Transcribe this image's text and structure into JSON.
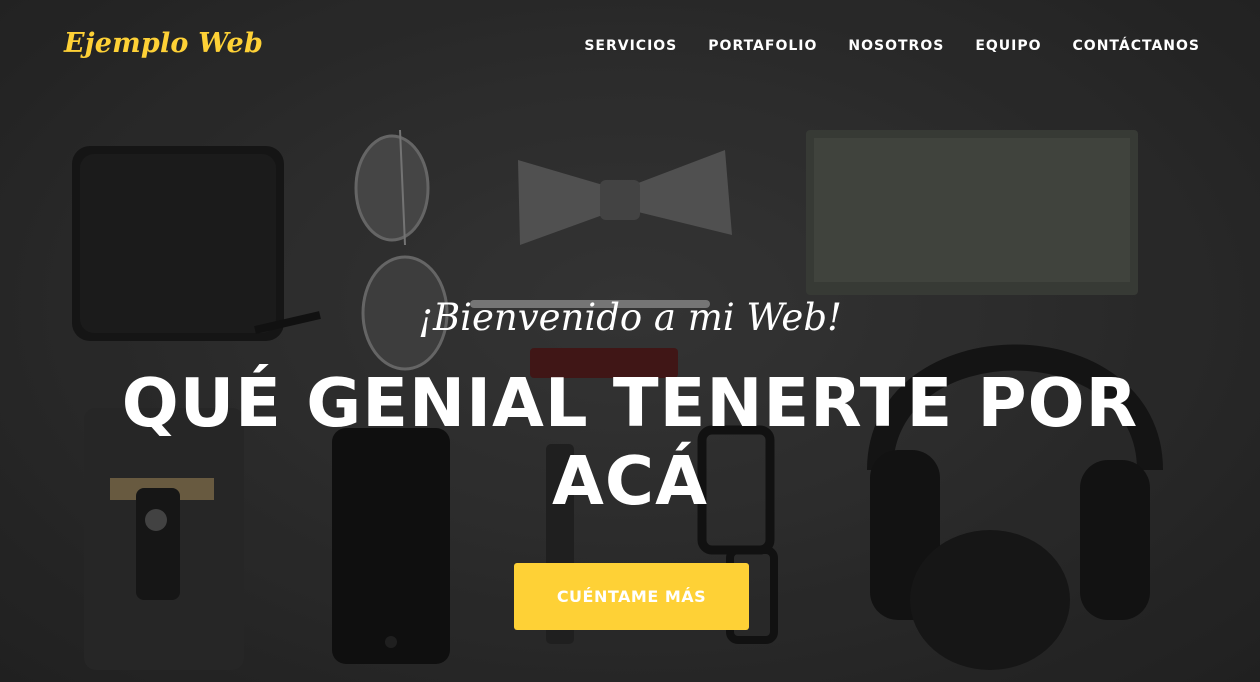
{
  "navbar": {
    "brand": "Ejemplo Web",
    "links": [
      "Servicios",
      "Portafolio",
      "Nosotros",
      "Equipo",
      "Contáctanos"
    ]
  },
  "hero": {
    "lead_in": "¡Bienvenido a mi Web!",
    "heading": "Qué genial tenerte por acá",
    "cta_label": "Cuéntame más",
    "background_image": "flat-lay of accessories: wallet, sunglasses, bow tie, notebook, pen, phone case, smartphone, watch, eyeglasses, headphones"
  },
  "colors": {
    "accent": "#fed136",
    "text": "#ffffff",
    "background": "#2e2e2e"
  }
}
